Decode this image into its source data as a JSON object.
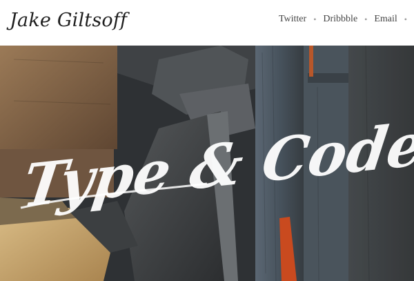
{
  "header": {
    "site_title": "Jake Giltsoff",
    "nav": [
      {
        "label": "Twitter"
      },
      {
        "label": "Dribbble"
      },
      {
        "label": "Email"
      }
    ]
  },
  "hero": {
    "headline": "Type & Code",
    "image_subject": "wooden letterpress type blocks",
    "palette": {
      "dark": "#2f3336",
      "wood": "#8a6a4a",
      "light_wood": "#c9a771",
      "slate": "#4d5964",
      "accent_red": "#c23a22"
    }
  }
}
